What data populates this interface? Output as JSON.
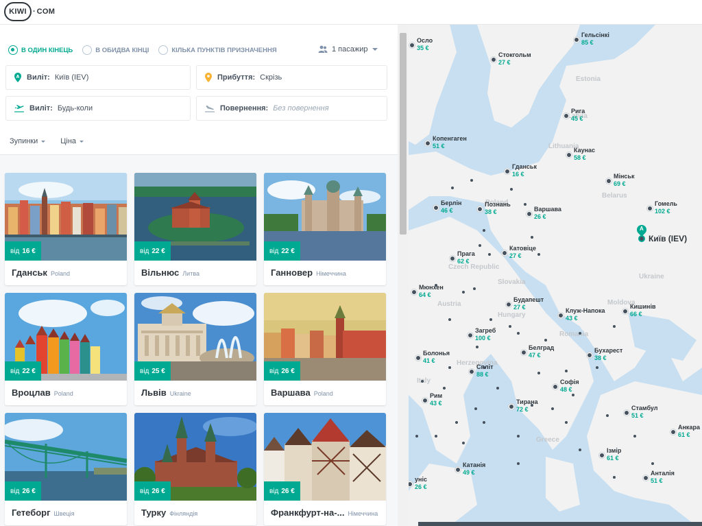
{
  "logo": {
    "brand": "KIWI",
    "suffix": "COM"
  },
  "search": {
    "trip_types": [
      {
        "label": "В ОДИН КІНЕЦЬ",
        "selected": true
      },
      {
        "label": "В ОБИДВА КІНЦІ",
        "selected": false
      },
      {
        "label": "КІЛЬКА ПУНКТІВ ПРИЗНАЧЕННЯ",
        "selected": false
      }
    ],
    "passengers": "1 пасажир",
    "from": {
      "label": "Виліт:",
      "value": "Київ (IEV)"
    },
    "to": {
      "label": "Прибуття:",
      "value": "Скрізь"
    },
    "departure": {
      "label": "Виліт:",
      "value": "Будь-коли"
    },
    "return": {
      "label": "Повернення:",
      "placeholder": "Без повернення"
    },
    "filters": [
      {
        "label": "Зупинки"
      },
      {
        "label": "Ціна"
      }
    ]
  },
  "price_prefix": "від",
  "cards": [
    {
      "city": "Гданськ",
      "country": "Poland",
      "price": "16 €",
      "scene": "harbor"
    },
    {
      "city": "Вільнюс",
      "country": "Литва",
      "price": "22 €",
      "scene": "castle"
    },
    {
      "city": "Ганновер",
      "country": "Німеччина",
      "price": "22 €",
      "scene": "townhall"
    },
    {
      "city": "Вроцлав",
      "country": "Poland",
      "price": "22 €",
      "scene": "houses"
    },
    {
      "city": "Львів",
      "country": "Ukraine",
      "price": "25 €",
      "scene": "opera"
    },
    {
      "city": "Варшава",
      "country": "Poland",
      "price": "26 €",
      "scene": "oldtown"
    },
    {
      "city": "Гетеборг",
      "country": "Швеція",
      "price": "26 €",
      "scene": "bridge"
    },
    {
      "city": "Турку",
      "country": "Фінляндія",
      "price": "26 €",
      "scene": "church"
    },
    {
      "city": "Франкфурт-на-...",
      "country": "Німеччина",
      "price": "26 €",
      "scene": "timbered"
    }
  ],
  "map": {
    "origin": "Київ (IEV)",
    "country_labels": [
      "Estonia",
      "Latvia",
      "Lithuania",
      "Poland",
      "Belarus",
      "Czech Republic",
      "Slovakia",
      "Austria",
      "Hungary",
      "Moldova",
      "Romania",
      "Ukraine",
      "Italy",
      "Herzegovina",
      "Greece"
    ],
    "cities": [
      {
        "name": "Осло",
        "price": "35 €"
      },
      {
        "name": "Гельсінкі",
        "price": "85 €"
      },
      {
        "name": "Стокгольм",
        "price": "27 €"
      },
      {
        "name": "Рига",
        "price": "45 €"
      },
      {
        "name": "Копенгаген",
        "price": "51 €"
      },
      {
        "name": "Каунас",
        "price": "58 €"
      },
      {
        "name": "Гданськ",
        "price": "16 €"
      },
      {
        "name": "Мінськ",
        "price": "69 €"
      },
      {
        "name": "Берлін",
        "price": "46 €"
      },
      {
        "name": "Познань",
        "price": "38 €"
      },
      {
        "name": "Варшава",
        "price": "26 €"
      },
      {
        "name": "Гомель",
        "price": "102 €"
      },
      {
        "name": "Прага",
        "price": "62 €"
      },
      {
        "name": "Катовіце",
        "price": "27 €"
      },
      {
        "name": "Мюнхен",
        "price": "64 €"
      },
      {
        "name": "Будапешт",
        "price": "27 €"
      },
      {
        "name": "Клуж-Напока",
        "price": "43 €"
      },
      {
        "name": "Кишинів",
        "price": "66 €"
      },
      {
        "name": "Загреб",
        "price": "100 €"
      },
      {
        "name": "Болонья",
        "price": "41 €"
      },
      {
        "name": "Белград",
        "price": "47 €"
      },
      {
        "name": "Бухарест",
        "price": "38 €"
      },
      {
        "name": "Спліт",
        "price": "88 €"
      },
      {
        "name": "Софія",
        "price": "48 €"
      },
      {
        "name": "Рим",
        "price": "43 €"
      },
      {
        "name": "Тирана",
        "price": "72 €"
      },
      {
        "name": "Стамбул",
        "price": "51 €"
      },
      {
        "name": "Анкара",
        "price": "61 €"
      },
      {
        "name": "Ізмір",
        "price": "61 €"
      },
      {
        "name": "Катанія",
        "price": "49 €"
      },
      {
        "name": "Анталія",
        "price": "51 €"
      },
      {
        "name": "уніс",
        "price": "26 €"
      }
    ]
  },
  "colors": {
    "accent": "#00a991",
    "text": "#2e353b",
    "water": "#c7dff0",
    "land": "#f2f2f2"
  }
}
